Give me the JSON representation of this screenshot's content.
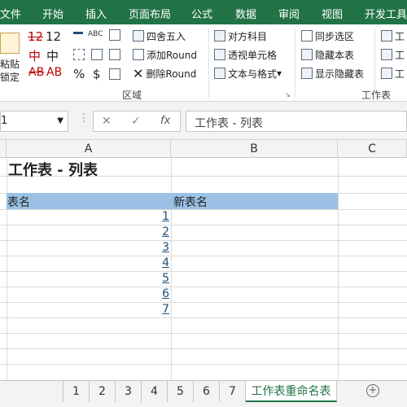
{
  "tabs": [
    "文件",
    "开始",
    "插入",
    "页面布局",
    "公式",
    "数据",
    "审阅",
    "视图",
    "开发工具"
  ],
  "ribbon": {
    "paste_label": "粘贴",
    "lock_label": "锁定",
    "nums": [
      "12",
      "12"
    ],
    "icon_texts": [
      "%",
      "$"
    ],
    "small_text": "ABC",
    "buttons": [
      "四舍五入",
      "添加Round",
      "删除Round",
      "对方科目",
      "透视单元格",
      "文本与格式",
      "同步选区",
      "隐藏本表",
      "显示隐藏表"
    ],
    "group_area": "区域",
    "group_sheet": "工作表",
    "right_cut": "工",
    "dropdown_arrow": "▾"
  },
  "formula_bar": {
    "name_box": "1",
    "cancel_glyph": "✕",
    "enter_glyph": "✓",
    "fx_glyph": "fx",
    "formula": "工作表 - 列表"
  },
  "grid": {
    "columns": [
      "A",
      "B",
      "C"
    ],
    "title": "工作表 - 列表",
    "header_a": "表名",
    "header_b": "新表名",
    "links": [
      "1",
      "2",
      "3",
      "4",
      "5",
      "6",
      "7"
    ]
  },
  "sheets": {
    "tabs": [
      "1",
      "2",
      "3",
      "4",
      "5",
      "6",
      "7"
    ],
    "active": "工作表重命名表"
  },
  "colors": {
    "ribbon_green": "#217346",
    "header_fill": "#9bc2e6",
    "link_blue": "#1f4e79"
  }
}
